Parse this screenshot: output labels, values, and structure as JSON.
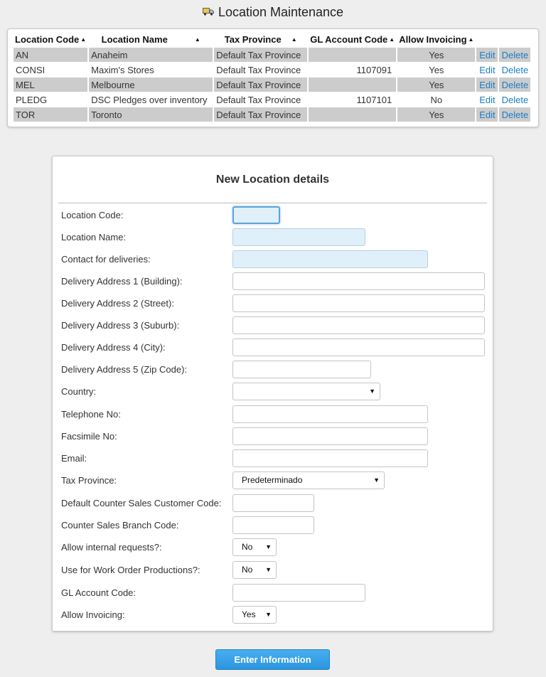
{
  "page": {
    "title": "Location Maintenance"
  },
  "table": {
    "headers": [
      "Location Code",
      "Location Name",
      "Tax Province",
      "GL Account Code",
      "Allow Invoicing"
    ],
    "sort_glyph": "▲",
    "rows": [
      {
        "code": "AN",
        "name": "Anaheim",
        "tax": "Default Tax Province",
        "gl": "",
        "invoicing": "Yes",
        "edit": "Edit",
        "delete": "Delete"
      },
      {
        "code": "CONSI",
        "name": "Maxim's Stores",
        "tax": "Default Tax Province",
        "gl": "1107091",
        "invoicing": "Yes",
        "edit": "Edit",
        "delete": "Delete"
      },
      {
        "code": "MEL",
        "name": "Melbourne",
        "tax": "Default Tax Province",
        "gl": "",
        "invoicing": "Yes",
        "edit": "Edit",
        "delete": "Delete"
      },
      {
        "code": "PLEDG",
        "name": "DSC Pledges over inventory",
        "tax": "Default Tax Province",
        "gl": "1107101",
        "invoicing": "No",
        "edit": "Edit",
        "delete": "Delete"
      },
      {
        "code": "TOR",
        "name": "Toronto",
        "tax": "Default Tax Province",
        "gl": "",
        "invoicing": "Yes",
        "edit": "Edit",
        "delete": "Delete"
      }
    ]
  },
  "form": {
    "title": "New Location details",
    "fields": {
      "location_code": {
        "label": "Location Code:",
        "value": ""
      },
      "location_name": {
        "label": "Location Name:",
        "value": ""
      },
      "contact": {
        "label": "Contact for deliveries:",
        "value": ""
      },
      "addr1": {
        "label": "Delivery Address 1 (Building):",
        "value": ""
      },
      "addr2": {
        "label": "Delivery Address 2 (Street):",
        "value": ""
      },
      "addr3": {
        "label": "Delivery Address 3 (Suburb):",
        "value": ""
      },
      "addr4": {
        "label": "Delivery Address 4 (City):",
        "value": ""
      },
      "addr5": {
        "label": "Delivery Address 5 (Zip Code):",
        "value": ""
      },
      "country": {
        "label": "Country:",
        "value": ""
      },
      "telephone": {
        "label": "Telephone No:",
        "value": ""
      },
      "facsimile": {
        "label": "Facsimile No:",
        "value": ""
      },
      "email": {
        "label": "Email:",
        "value": ""
      },
      "tax_province": {
        "label": "Tax Province:",
        "value": "Predeterminado"
      },
      "counter_customer": {
        "label": "Default Counter Sales Customer Code:",
        "value": ""
      },
      "counter_branch": {
        "label": "Counter Sales Branch Code:",
        "value": ""
      },
      "internal_requests": {
        "label": "Allow internal requests?:",
        "value": "No"
      },
      "work_orders": {
        "label": "Use for Work Order Productions?:",
        "value": "No"
      },
      "gl_account": {
        "label": "GL Account Code:",
        "value": ""
      },
      "allow_invoicing": {
        "label": "Allow Invoicing:",
        "value": "Yes"
      }
    },
    "select_caret": "▼",
    "submit_label": "Enter Information"
  },
  "colors": {
    "accent": "#2b95de",
    "link": "#1a7ec4",
    "row_shade": "#cccccc",
    "focus_fill": "#dff0fa"
  },
  "icons": {
    "title_icon": "truck-icon"
  }
}
